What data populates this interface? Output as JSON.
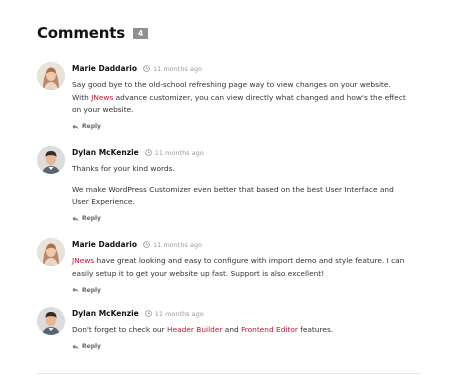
{
  "header": {
    "title": "Comments",
    "count": "4"
  },
  "comments": [
    {
      "author": "Marie Daddario",
      "time": "11 months ago",
      "paragraphs": [
        [
          {
            "text": "Say good bye to the old-school refreshing page way to view changes on your website."
          },
          {
            "text": "With "
          },
          {
            "text": "JNews",
            "link": true
          },
          {
            "text": " advance customizer, you can view directly what changed and how's the effect"
          },
          {
            "text": "on your website."
          }
        ]
      ],
      "reply": "Reply",
      "avatar": "female-avatar"
    },
    {
      "author": "Dylan McKenzie",
      "time": "11 months ago",
      "paragraphs": [
        [
          {
            "text": "Thanks for your kind words."
          }
        ],
        [
          {
            "text": "We make WordPress Customizer even better that based on the best User Interface and"
          },
          {
            "text": "User Experience."
          }
        ]
      ],
      "reply": "Reply",
      "avatar": "male-avatar"
    },
    {
      "author": "Marie Daddario",
      "time": "11 months ago",
      "paragraphs": [
        [
          {
            "text": "JNews",
            "link": true
          },
          {
            "text": " have great looking and easy to configure with import demo and style feature. I can"
          },
          {
            "text": "easily setup it to get your website up fast. Support is also excellent!"
          }
        ]
      ],
      "reply": "Reply",
      "avatar": "female-avatar"
    },
    {
      "author": "Dylan McKenzie",
      "time": "11 months ago",
      "paragraphs": [
        [
          {
            "text": "Don't forget to check our "
          },
          {
            "text": "Header Builder",
            "link": true
          },
          {
            "text": " and "
          },
          {
            "text": "Frontend Editor",
            "link": true
          },
          {
            "text": " features."
          }
        ]
      ],
      "reply": "Reply",
      "avatar": "male-avatar"
    }
  ],
  "colors": {
    "link": "#c8102e",
    "badge": "#8f8f8f",
    "meta": "#999999"
  }
}
